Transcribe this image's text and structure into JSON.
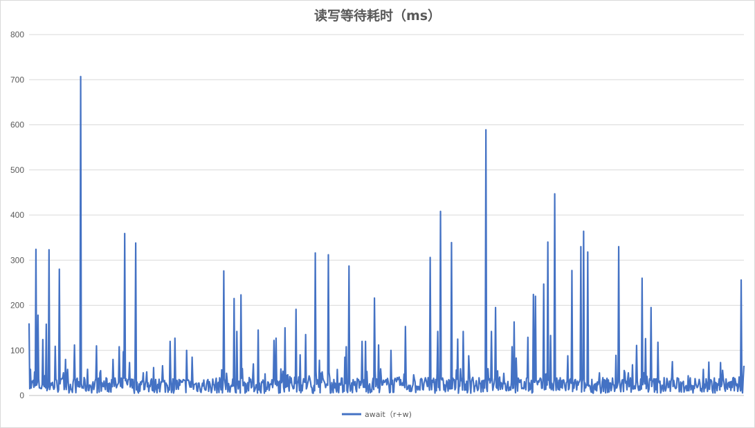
{
  "chart_data": {
    "type": "line",
    "title": "读写等待耗时（ms）",
    "ylim": [
      0,
      800
    ],
    "yticks": [
      0,
      100,
      200,
      300,
      400,
      500,
      600,
      700,
      800
    ],
    "grid": true,
    "legend_position": "bottom",
    "line_color": "#4472C4",
    "series": [
      {
        "name": "await（r+w)",
        "x_count": 1040,
        "baseline_range": [
          5,
          40
        ],
        "peaks": [
          {
            "x": 20,
            "y": 140
          },
          {
            "x": 23,
            "y": 160
          },
          {
            "x": 44,
            "y": 58
          },
          {
            "x": 52,
            "y": 324
          },
          {
            "x": 55,
            "y": 178
          },
          {
            "x": 62,
            "y": 124
          },
          {
            "x": 67,
            "y": 158
          },
          {
            "x": 71,
            "y": 323
          },
          {
            "x": 80,
            "y": 109
          },
          {
            "x": 86,
            "y": 280
          },
          {
            "x": 95,
            "y": 80
          },
          {
            "x": 108,
            "y": 112
          },
          {
            "x": 117,
            "y": 707
          },
          {
            "x": 127,
            "y": 58
          },
          {
            "x": 139,
            "y": 110
          },
          {
            "x": 145,
            "y": 55
          },
          {
            "x": 163,
            "y": 80
          },
          {
            "x": 172,
            "y": 108
          },
          {
            "x": 178,
            "y": 97
          },
          {
            "x": 180,
            "y": 359
          },
          {
            "x": 187,
            "y": 73
          },
          {
            "x": 196,
            "y": 338
          },
          {
            "x": 222,
            "y": 62
          },
          {
            "x": 235,
            "y": 66
          },
          {
            "x": 246,
            "y": 120
          },
          {
            "x": 253,
            "y": 127
          },
          {
            "x": 270,
            "y": 100
          },
          {
            "x": 278,
            "y": 85
          },
          {
            "x": 320,
            "y": 57
          },
          {
            "x": 323,
            "y": 276
          },
          {
            "x": 338,
            "y": 215
          },
          {
            "x": 342,
            "y": 142
          },
          {
            "x": 348,
            "y": 223
          },
          {
            "x": 366,
            "y": 70
          },
          {
            "x": 373,
            "y": 145
          },
          {
            "x": 396,
            "y": 122
          },
          {
            "x": 399,
            "y": 127
          },
          {
            "x": 412,
            "y": 150
          },
          {
            "x": 428,
            "y": 191
          },
          {
            "x": 434,
            "y": 90
          },
          {
            "x": 442,
            "y": 135
          },
          {
            "x": 456,
            "y": 316
          },
          {
            "x": 462,
            "y": 78
          },
          {
            "x": 474,
            "y": 312
          },
          {
            "x": 498,
            "y": 85
          },
          {
            "x": 500,
            "y": 108
          },
          {
            "x": 504,
            "y": 287
          },
          {
            "x": 523,
            "y": 120
          },
          {
            "x": 528,
            "y": 120
          },
          {
            "x": 541,
            "y": 216
          },
          {
            "x": 547,
            "y": 112
          },
          {
            "x": 565,
            "y": 100
          },
          {
            "x": 586,
            "y": 153
          },
          {
            "x": 622,
            "y": 306
          },
          {
            "x": 633,
            "y": 142
          },
          {
            "x": 637,
            "y": 408
          },
          {
            "x": 652,
            "y": 339
          },
          {
            "x": 661,
            "y": 125
          },
          {
            "x": 669,
            "y": 142
          },
          {
            "x": 677,
            "y": 88
          },
          {
            "x": 702,
            "y": 589
          },
          {
            "x": 710,
            "y": 142
          },
          {
            "x": 716,
            "y": 195
          },
          {
            "x": 740,
            "y": 108
          },
          {
            "x": 743,
            "y": 163
          },
          {
            "x": 746,
            "y": 83
          },
          {
            "x": 763,
            "y": 129
          },
          {
            "x": 771,
            "y": 224
          },
          {
            "x": 774,
            "y": 220
          },
          {
            "x": 786,
            "y": 247
          },
          {
            "x": 792,
            "y": 340
          },
          {
            "x": 796,
            "y": 133
          },
          {
            "x": 802,
            "y": 447
          },
          {
            "x": 820,
            "y": 88
          },
          {
            "x": 826,
            "y": 277
          },
          {
            "x": 839,
            "y": 330
          },
          {
            "x": 843,
            "y": 364
          },
          {
            "x": 849,
            "y": 318
          },
          {
            "x": 890,
            "y": 89
          },
          {
            "x": 894,
            "y": 330
          },
          {
            "x": 914,
            "y": 68
          },
          {
            "x": 920,
            "y": 111
          },
          {
            "x": 928,
            "y": 260
          },
          {
            "x": 933,
            "y": 126
          },
          {
            "x": 941,
            "y": 195
          },
          {
            "x": 951,
            "y": 118
          },
          {
            "x": 972,
            "y": 75
          },
          {
            "x": 1024,
            "y": 74
          },
          {
            "x": 1041,
            "y": 73
          },
          {
            "x": 1071,
            "y": 256
          },
          {
            "x": 1075,
            "y": 66
          }
        ]
      }
    ]
  }
}
